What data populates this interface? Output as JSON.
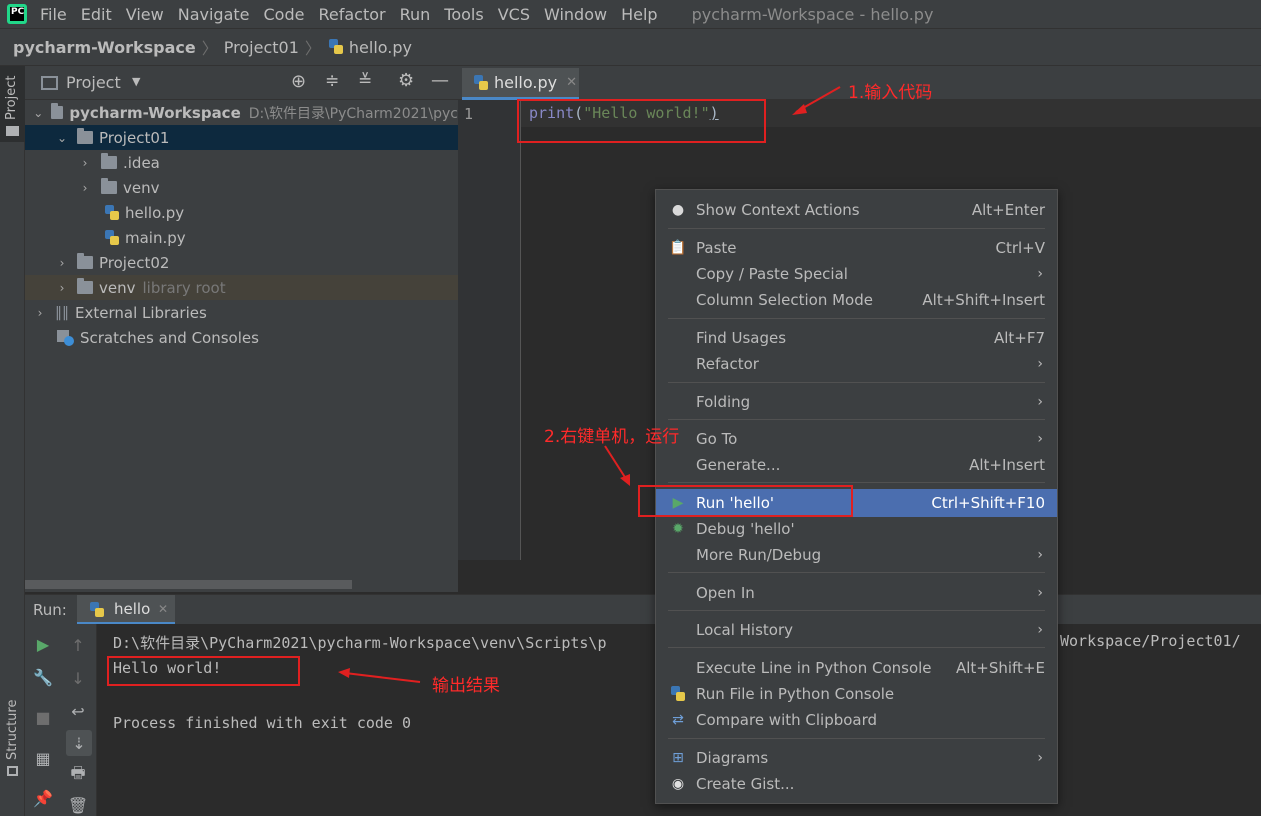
{
  "app": {
    "logo_text": "PC",
    "menu": [
      "File",
      "Edit",
      "View",
      "Navigate",
      "Code",
      "Refactor",
      "Run",
      "Tools",
      "VCS",
      "Window",
      "Help"
    ],
    "window_title": "pycharm-Workspace - hello.py"
  },
  "breadcrumb": {
    "workspace": "pycharm-Workspace",
    "project": "Project01",
    "file": "hello.py"
  },
  "left_stripe": {
    "project_label": "Project",
    "structure_label": "Structure"
  },
  "project_panel": {
    "title": "Project",
    "tree": [
      {
        "label": "pycharm-Workspace",
        "hint": "D:\\软件目录\\PyCharm2021\\pyc"
      },
      {
        "label": "Project01"
      },
      {
        "label": ".idea"
      },
      {
        "label": "venv"
      },
      {
        "label": "hello.py"
      },
      {
        "label": "main.py"
      },
      {
        "label": "Project02"
      },
      {
        "label": "venv",
        "hint": "library root"
      },
      {
        "label": "External Libraries"
      },
      {
        "label": "Scratches and Consoles"
      }
    ]
  },
  "editor": {
    "tab_label": "hello.py",
    "line_number": "1",
    "code": {
      "func": "print",
      "open": "(",
      "string": "\"Hello world!\"",
      "close": ")"
    }
  },
  "run_panel": {
    "label": "Run:",
    "tab_label": "hello",
    "console": {
      "command_left": "D:\\软件目录\\PyCharm2021\\pycharm-Workspace\\venv\\Scripts\\p",
      "command_right": "Workspace/Project01/",
      "output": "Hello world!",
      "finished": "Process finished with exit code 0"
    }
  },
  "context_menu": {
    "items": [
      {
        "label": "Show Context Actions",
        "shortcut": "Alt+Enter",
        "icon": "bulb-icon"
      },
      {
        "label": "Paste",
        "shortcut": "Ctrl+V",
        "icon": "clipboard-icon"
      },
      {
        "label": "Copy / Paste Special",
        "submenu": true
      },
      {
        "label": "Column Selection Mode",
        "shortcut": "Alt+Shift+Insert"
      },
      {
        "label": "Find Usages",
        "shortcut": "Alt+F7"
      },
      {
        "label": "Refactor",
        "submenu": true
      },
      {
        "label": "Folding",
        "submenu": true
      },
      {
        "label": "Go To",
        "submenu": true
      },
      {
        "label": "Generate...",
        "shortcut": "Alt+Insert"
      },
      {
        "label": "Run 'hello'",
        "shortcut": "Ctrl+Shift+F10",
        "icon": "run-icon",
        "highlighted": true
      },
      {
        "label": "Debug 'hello'",
        "icon": "debug-icon"
      },
      {
        "label": "More Run/Debug",
        "submenu": true
      },
      {
        "label": "Open In",
        "submenu": true
      },
      {
        "label": "Local History",
        "submenu": true
      },
      {
        "label": "Execute Line in Python Console",
        "shortcut": "Alt+Shift+E"
      },
      {
        "label": "Run File in Python Console",
        "icon": "python-icon"
      },
      {
        "label": "Compare with Clipboard",
        "icon": "compare-icon"
      },
      {
        "label": "Diagrams",
        "submenu": true,
        "icon": "diagram-icon"
      },
      {
        "label": "Create Gist...",
        "icon": "github-icon"
      }
    ]
  },
  "annotations": {
    "step1": "1.输入代码",
    "step2": "2.右键单机，运行",
    "output": "输出结果"
  },
  "colors": {
    "accent": "#4a88c7",
    "highlight": "#4b6eaf",
    "annotation_red": "#e02020",
    "code_func": "#8888c6",
    "code_string": "#6a8759"
  }
}
